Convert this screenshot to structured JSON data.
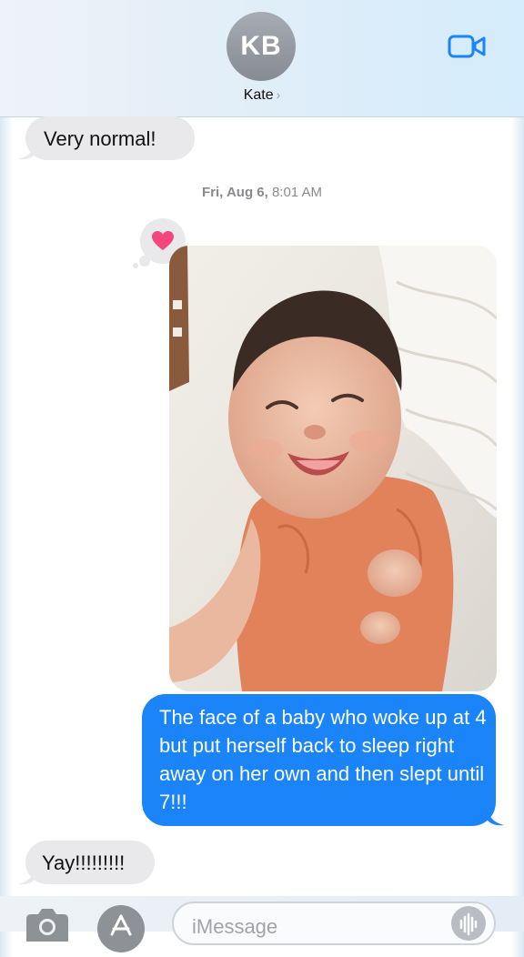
{
  "header": {
    "avatar_initials": "KB",
    "contact_name": "Kate",
    "chevron": "›",
    "video_icon": "video-camera-icon"
  },
  "messages": {
    "received_1": "Very normal!",
    "timestamp_day": "Fri, Aug 6,",
    "timestamp_time": "8:01 AM",
    "tapback_icon": "heart-icon",
    "photo_desc_icon": "photo-attachment",
    "sent_1": "The face of a baby who woke up at 4 but put herself back to sleep right away on her own and then slept until 7!!!",
    "received_2": "Yay!!!!!!!!!"
  },
  "composer": {
    "placeholder": "iMessage",
    "camera_icon": "camera-icon",
    "apps_icon": "app-store-icon",
    "audio_icon": "audio-waveform-icon"
  },
  "colors": {
    "sent_bubble": "#1a84f8",
    "received_bubble": "#e9e9eb",
    "heart": "#f2467d",
    "ios_blue": "#1a84f8"
  }
}
